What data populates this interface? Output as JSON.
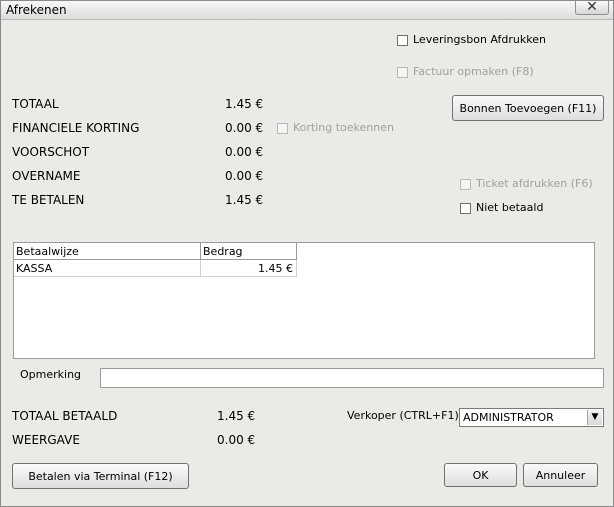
{
  "window": {
    "title": "Afrekenen",
    "close_glyph": "✕"
  },
  "options": {
    "leveringsbon": "Leveringsbon Afdrukken",
    "factuur": "Factuur opmaken (F8)",
    "korting_toekennen": "Korting toekennen",
    "ticket": "Ticket afdrukken (F6)",
    "niet_betaald": "Niet betaald"
  },
  "summary": {
    "totaal_label": "TOTAAL",
    "totaal_value": "1.45 €",
    "korting_label": "FINANCIELE KORTING",
    "korting_value": "0.00 €",
    "voorschot_label": "VOORSCHOT",
    "voorschot_value": "0.00 €",
    "overname_label": "OVERNAME",
    "overname_value": "0.00 €",
    "te_betalen_label": "TE BETALEN",
    "te_betalen_value": "1.45 €"
  },
  "buttons": {
    "bonnen": "Bonnen Toevoegen (F11)",
    "terminal": "Betalen via Terminal (F12)",
    "ok": "OK",
    "annuleer": "Annuleer"
  },
  "payments": {
    "columns": [
      "Betaalwijze",
      "Bedrag"
    ],
    "rows": [
      {
        "method": "KASSA",
        "amount": "1.45 €"
      }
    ]
  },
  "remark": {
    "label": "Opmerking",
    "value": ""
  },
  "footer": {
    "totaal_betaald_label": "TOTAAL BETAALD",
    "totaal_betaald_value": "1.45 €",
    "weergave_label": "WEERGAVE",
    "weergave_value": "0.00 €",
    "verkoper_label": "Verkoper (CTRL+F1)",
    "verkoper_value": "ADMINISTRATOR"
  }
}
